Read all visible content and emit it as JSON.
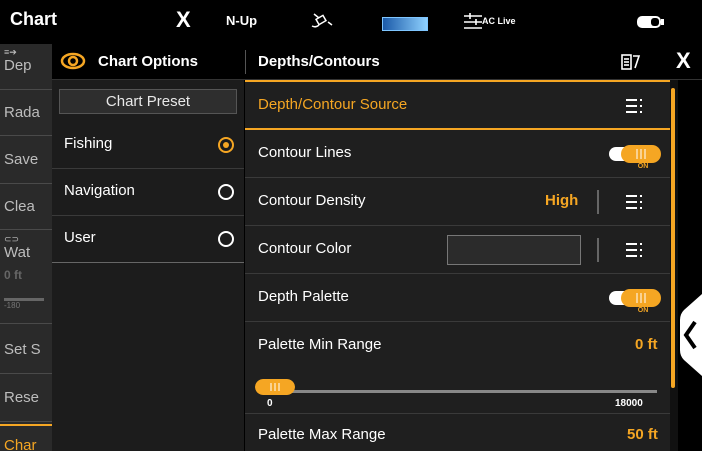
{
  "statusbar": {
    "title": "Chart",
    "x_label": "X",
    "view_mode": "N-Up",
    "aclive_label": "AC Live",
    "icons": [
      "satellite-icon",
      "signal-gradient-bar",
      "aclive-icon",
      "battery-icon"
    ]
  },
  "background_menu": {
    "items": [
      "Dep",
      "Rada",
      "Save",
      "Clea",
      "Wat",
      "0 ft",
      "-180",
      "Set S",
      "Rese",
      "Char"
    ]
  },
  "dialog": {
    "title": "Chart Options",
    "section": "Depths/Contours",
    "close_label": "X",
    "preset_button": "Chart Preset",
    "presets": [
      {
        "label": "Fishing",
        "selected": true
      },
      {
        "label": "Navigation",
        "selected": false
      },
      {
        "label": "User",
        "selected": false
      }
    ],
    "options": [
      {
        "label": "Depth/Contour Source",
        "control": "menu",
        "active": true
      },
      {
        "label": "Contour Lines",
        "control": "toggle",
        "state": "ON"
      },
      {
        "label": "Contour Density",
        "control": "value-menu",
        "value": "High"
      },
      {
        "label": "Contour Color",
        "control": "color-menu",
        "value": ""
      },
      {
        "label": "Depth Palette",
        "control": "toggle",
        "state": "ON"
      },
      {
        "label": "Palette Min Range",
        "control": "value",
        "value": "0 ft"
      },
      {
        "label": "Palette Max Range",
        "control": "value",
        "value": "50 ft"
      }
    ],
    "slider": {
      "min_label": "0",
      "max_label": "18000",
      "value": 0
    }
  },
  "colors": {
    "accent": "#f5a623",
    "panel": "#1f1f1f",
    "background": "#000000"
  }
}
